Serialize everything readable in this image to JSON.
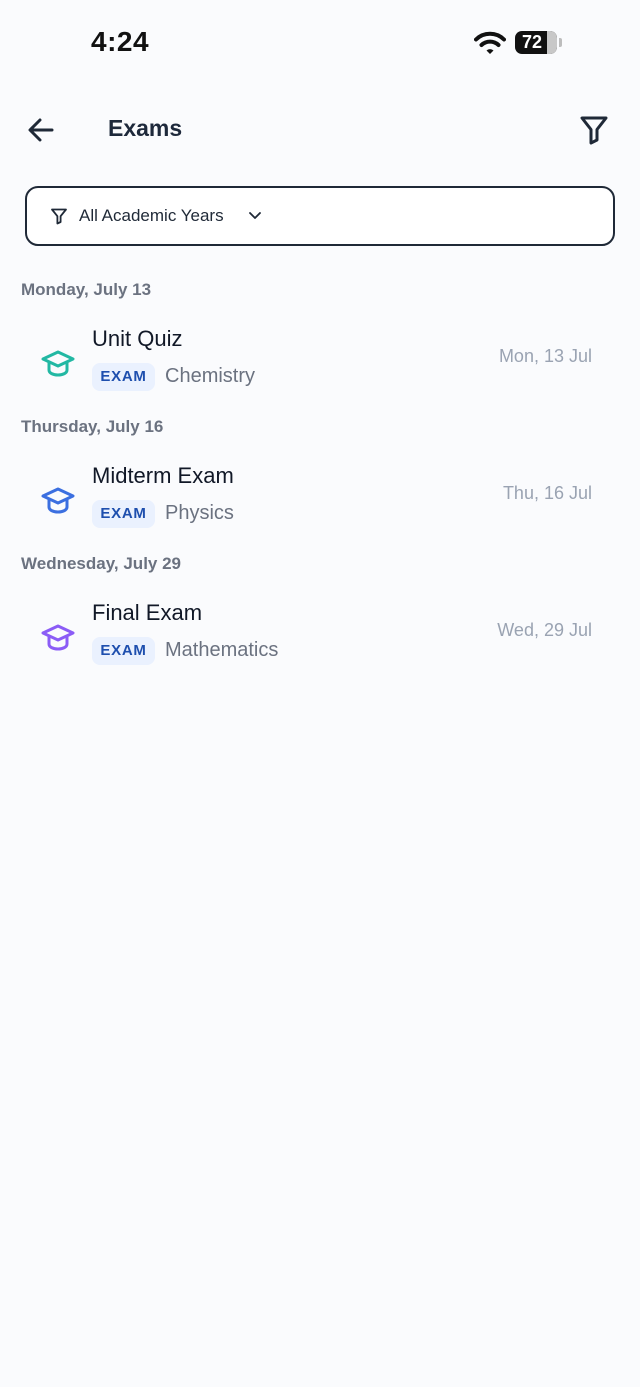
{
  "status_bar": {
    "time": "4:24",
    "battery": "72"
  },
  "header": {
    "title": "Exams",
    "back_icon": "arrow-left-icon",
    "filter_icon": "funnel-icon"
  },
  "year_filter": {
    "label": "All Academic Years",
    "icon": "funnel-icon",
    "chevron": "chevron-down-icon"
  },
  "colors": {
    "background": "#fafbfd",
    "badge_bg": "#eaf1fe",
    "badge_text": "#1e4fae",
    "chemistry_icon": "#22b8a3",
    "physics_icon": "#3b6fe0",
    "mathematics_icon": "#8b5cf6"
  },
  "sections": [
    {
      "date_header": "Monday, July 13",
      "items": [
        {
          "title": "Unit Quiz",
          "badge": "EXAM",
          "subject": "Chemistry",
          "date": "Mon, 13 Jul",
          "icon": "graduation-cap-icon",
          "icon_color": "#22b8a3"
        }
      ]
    },
    {
      "date_header": "Thursday, July 16",
      "items": [
        {
          "title": "Midterm Exam",
          "badge": "EXAM",
          "subject": "Physics",
          "date": "Thu, 16 Jul",
          "icon": "graduation-cap-icon",
          "icon_color": "#3b6fe0"
        }
      ]
    },
    {
      "date_header": "Wednesday, July 29",
      "items": [
        {
          "title": "Final Exam",
          "badge": "EXAM",
          "subject": "Mathematics",
          "date": "Wed, 29 Jul",
          "icon": "graduation-cap-icon",
          "icon_color": "#8b5cf6"
        }
      ]
    }
  ]
}
